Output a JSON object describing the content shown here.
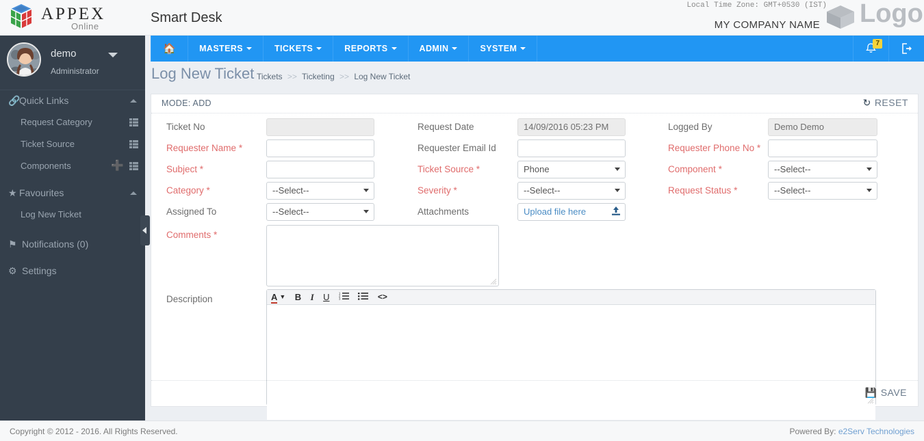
{
  "topbar": {
    "brand_name": "APPEX",
    "brand_sub": "Online",
    "app_title": "Smart Desk",
    "timezone": "Local Time Zone: GMT+0530 (IST)",
    "company": "MY COMPANY NAME",
    "right_logo_text": "Logo",
    "cube_icon": "cube-logo-icon",
    "box_icon": "box-logo-icon"
  },
  "sidebar": {
    "user": {
      "name": "demo",
      "role": "Administrator",
      "avatar": "user-avatar",
      "caret": "chevron-down-icon"
    },
    "groups": [
      {
        "label": "Quick Links",
        "icon": "link-icon",
        "caret": "chevron-up-icon",
        "items": [
          {
            "label": "Request Category",
            "list_icon": "list-grid-icon",
            "has_add": false
          },
          {
            "label": "Ticket Source",
            "list_icon": "list-grid-icon",
            "has_add": false
          },
          {
            "label": "Components",
            "list_icon": "list-grid-icon",
            "has_add": true,
            "add_icon": "plus-icon"
          }
        ]
      },
      {
        "label": "Favourites",
        "icon": "star-icon",
        "caret": "chevron-up-icon",
        "items": [
          {
            "label": "Log New Ticket",
            "list_icon": "",
            "has_add": false
          }
        ]
      }
    ],
    "links": [
      {
        "label": "Notifications (0)",
        "icon": "flag-icon"
      },
      {
        "label": "Settings",
        "icon": "gears-icon"
      }
    ],
    "collapse_handle": "sidebar-collapse-handle"
  },
  "navbar": {
    "home_icon": "home-icon",
    "items": [
      {
        "label": "MASTERS",
        "caret": true
      },
      {
        "label": "TICKETS",
        "caret": true
      },
      {
        "label": "REPORTS",
        "caret": true
      },
      {
        "label": "ADMIN",
        "caret": true
      },
      {
        "label": "SYSTEM",
        "caret": true
      }
    ],
    "notification": {
      "icon": "bell-icon",
      "count": "7",
      "badge_color": "#f5d33a"
    },
    "logout": {
      "icon": "logout-icon"
    },
    "accent_color": "#2196f3"
  },
  "page": {
    "title": "Log New Ticket",
    "breadcrumb": [
      "Tickets",
      "Ticketing",
      "Log New Ticket"
    ],
    "breadcrumb_separator": ">>"
  },
  "panel": {
    "mode": "MODE: ADD",
    "reset_label": "RESET",
    "reset_icon": "refresh-icon",
    "save_label": "SAVE",
    "save_icon": "floppy-save-icon"
  },
  "form": {
    "fields": {
      "ticket_no": {
        "label": "Ticket No",
        "required": false,
        "value": "",
        "type": "readonly"
      },
      "requester_name": {
        "label": "Requester Name",
        "required": true,
        "value": "",
        "type": "text"
      },
      "subject": {
        "label": "Subject",
        "required": true,
        "value": "",
        "type": "text"
      },
      "category": {
        "label": "Category",
        "required": true,
        "value": "--Select--",
        "type": "select"
      },
      "assigned_to": {
        "label": "Assigned To",
        "required": false,
        "value": "--Select--",
        "type": "select"
      },
      "request_date": {
        "label": "Request Date",
        "required": false,
        "value": "14/09/2016 05:23 PM",
        "type": "readonly"
      },
      "requester_email": {
        "label": "Requester Email Id",
        "required": false,
        "value": "",
        "type": "text"
      },
      "ticket_source": {
        "label": "Ticket Source",
        "required": true,
        "value": "Phone",
        "type": "select"
      },
      "severity": {
        "label": "Severity",
        "required": true,
        "value": "--Select--",
        "type": "select"
      },
      "attachments": {
        "label": "Attachments",
        "required": false,
        "value": "Upload file here",
        "type": "upload",
        "upload_icon": "upload-icon"
      },
      "logged_by": {
        "label": "Logged By",
        "required": false,
        "value": "Demo Demo",
        "type": "readonly"
      },
      "requester_phone": {
        "label": "Requester Phone No",
        "required": true,
        "value": "",
        "type": "text"
      },
      "component": {
        "label": "Component",
        "required": true,
        "value": "--Select--",
        "type": "select"
      },
      "request_status": {
        "label": "Request Status",
        "required": true,
        "value": "--Select--",
        "type": "select"
      },
      "comments": {
        "label": "Comments",
        "required": true,
        "value": "",
        "type": "textarea"
      },
      "description": {
        "label": "Description",
        "required": false,
        "value": "",
        "type": "richtext"
      }
    },
    "required_marker": "*",
    "required_color": "#e06c6c",
    "editor_toolbar": [
      {
        "glyph": "A",
        "name": "font-color-icon"
      },
      {
        "glyph": "B",
        "name": "bold-icon"
      },
      {
        "glyph": "I",
        "name": "italic-icon"
      },
      {
        "glyph": "U",
        "name": "underline-icon"
      },
      {
        "glyph": "≣",
        "name": "ordered-list-icon"
      },
      {
        "glyph": "≣",
        "name": "unordered-list-icon"
      },
      {
        "glyph": "<>",
        "name": "code-view-icon"
      }
    ]
  },
  "footer": {
    "copyright": "Copyright © 2012 - 2016. All Rights Reserved.",
    "powered_prefix": "Powered By: ",
    "powered_link": "e2Serv Technologies"
  }
}
